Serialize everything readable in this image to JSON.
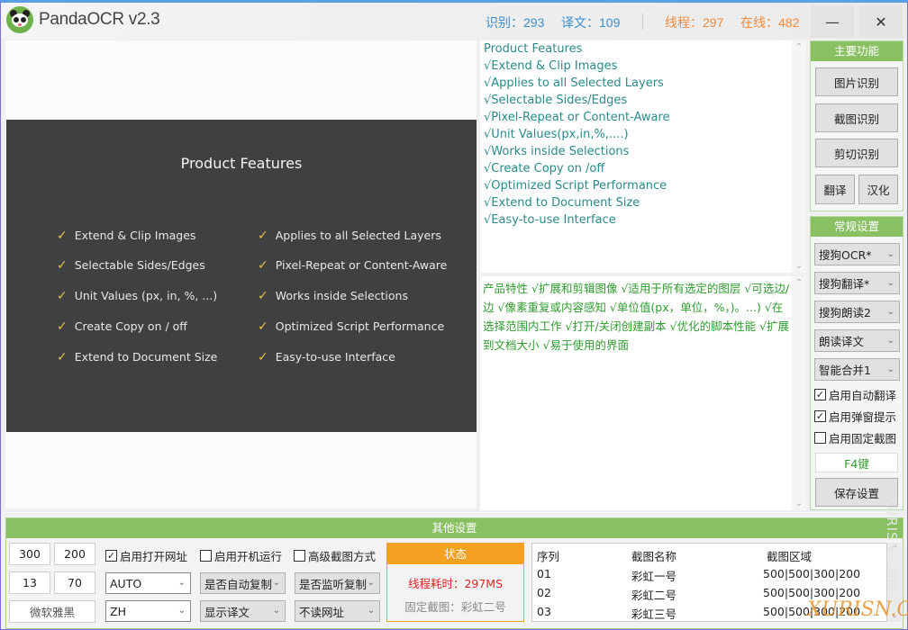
{
  "app": {
    "title": "PandaOCR v2.3",
    "stats": {
      "recognize": "识别：293",
      "translate": "译文：109",
      "threads": "线程：297",
      "online": "在线：482"
    },
    "minimize_label": "—",
    "close_label": "✕"
  },
  "image_panel": {
    "slide_title": "Product Features",
    "check_glyph": "✓",
    "features_left": [
      "Extend & Clip Images",
      "Selectable Sides/Edges",
      "Unit Values (px, in, %, ...)",
      "Create Copy on / off",
      "Extend to Document Size"
    ],
    "features_right": [
      "Applies to all Selected Layers",
      "Pixel-Repeat or Content-Aware",
      "Works inside Selections",
      "Optimized Script Performance",
      "Easy-to-use Interface"
    ]
  },
  "ocr_result": {
    "lines": [
      "Product Features",
      "√Extend & Clip Images",
      "√Applies to all Selected Layers",
      "√Selectable Sides/Edges",
      "√Pixel-Repeat or Content-Aware",
      "√Unit Values(px,in,%,....)",
      "√Works inside Selections",
      "√Create Copy on /off",
      "√Optimized Script Performance",
      "√Extend to Document Size",
      "√Easy-to-use Interface"
    ]
  },
  "translation": {
    "text": "产品特性 √扩展和剪辑图像 √适用于所有选定的图层 √可选边/边 √像素重复或内容感知 √单位值(px，单位，%，)。...) √在选择范围内工作 √打开/关闭创建副本 √优化的脚本性能 √扩展到文档大小 √易于使用的界面"
  },
  "scroll": {
    "up": "⌃",
    "down": "⌄"
  },
  "main_functions": {
    "header": "主要功能",
    "image_ocr": "图片识别",
    "screenshot_ocr": "截图识别",
    "clipboard_ocr": "剪切识别",
    "translate": "翻译",
    "localize": "汉化"
  },
  "general_settings": {
    "header": "常规设置",
    "ocr_engine": "搜狗OCR*",
    "translate_engine": "搜狗翻译*",
    "tts_engine": "搜狗朗读2",
    "read_mode": "朗读译文",
    "merge_mode": "智能合并1",
    "auto_translate": {
      "label": "启用自动翻译",
      "checked": true
    },
    "popup_hint": {
      "label": "启用弹窗提示",
      "checked": true
    },
    "fixed_capture": {
      "label": "启用固定截图",
      "checked": false
    },
    "hotkey": "F4键",
    "save": "保存设置",
    "chev": "⌄",
    "check_mark": "✓"
  },
  "other_settings": {
    "header": "其他设置",
    "width": "300",
    "height": "200",
    "font_size": "13",
    "opacity": "70",
    "font_name": "微软雅黑",
    "open_url": {
      "label": "启用打开网址",
      "checked": true
    },
    "startup": {
      "label": "启用开机运行",
      "checked": false
    },
    "advanced_capture": {
      "label": "高级截图方式",
      "checked": false
    },
    "source_lang": "AUTO",
    "target_lang": "ZH",
    "auto_copy": "是否自动复制",
    "listen_copy": "是否监听复制",
    "show_translation": "显示译文",
    "read_url": "不读网址"
  },
  "status": {
    "header": "状态",
    "thread_time": "线程耗时：297MS",
    "fixed_capture": "固定截图：彩虹二号"
  },
  "capture_table": {
    "columns": [
      "序列",
      "截图名称",
      "截图区域"
    ],
    "rows": [
      [
        "01",
        "彩虹一号",
        "500|500|300|200"
      ],
      [
        "02",
        "彩虹二号",
        "500|500|300|200"
      ],
      [
        "03",
        "彩虹三号",
        "500|500|300|200"
      ]
    ]
  },
  "watermark": {
    "vertical": "XURISN.COM",
    "horizontal": "XURISN.COM"
  }
}
